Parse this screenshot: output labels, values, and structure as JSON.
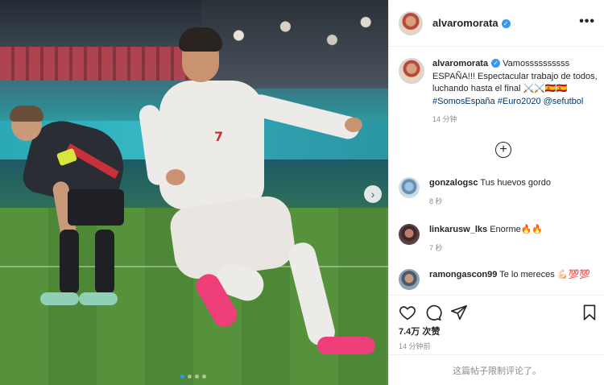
{
  "post": {
    "author": "alvaromorata",
    "caption_line1": "Vamossssssssss ESPAÑA!!! Espectacular trabajo de todos, luchando hasta el final ⚔️⚔️🇪🇸🇪🇸",
    "hashtag1": "#SomosEspaña",
    "hashtag2": "#Euro2020",
    "mention": "@sefutbol",
    "caption_time": "14 分钟",
    "likes": "7.4万 次赞",
    "post_time": "14 分钟前",
    "comments_limited": "这篇帖子限制评论了。",
    "carousel_count": 4,
    "carousel_active": 0
  },
  "comments": [
    {
      "user": "gonzalogsc",
      "text": "Tus huevos gordo",
      "time": "8 秒"
    },
    {
      "user": "linkarusw_lks",
      "text": "Enorme🔥🔥",
      "time": "7 秒"
    },
    {
      "user": "ramongascon99",
      "text": "Te lo mereces 💪🏻💯💯",
      "time": ""
    }
  ],
  "icons": {
    "verified": "verified-badge-icon",
    "more": "more-options-icon",
    "add": "load-more-comments-icon",
    "like": "heart-icon",
    "comment": "comment-icon",
    "share": "paper-plane-icon",
    "save": "bookmark-icon",
    "next": "chevron-right-icon"
  },
  "colors": {
    "verified": "#3897f0",
    "link": "#00376b",
    "muted": "#8e8e8e",
    "active_dot": "#1e9bf0"
  }
}
